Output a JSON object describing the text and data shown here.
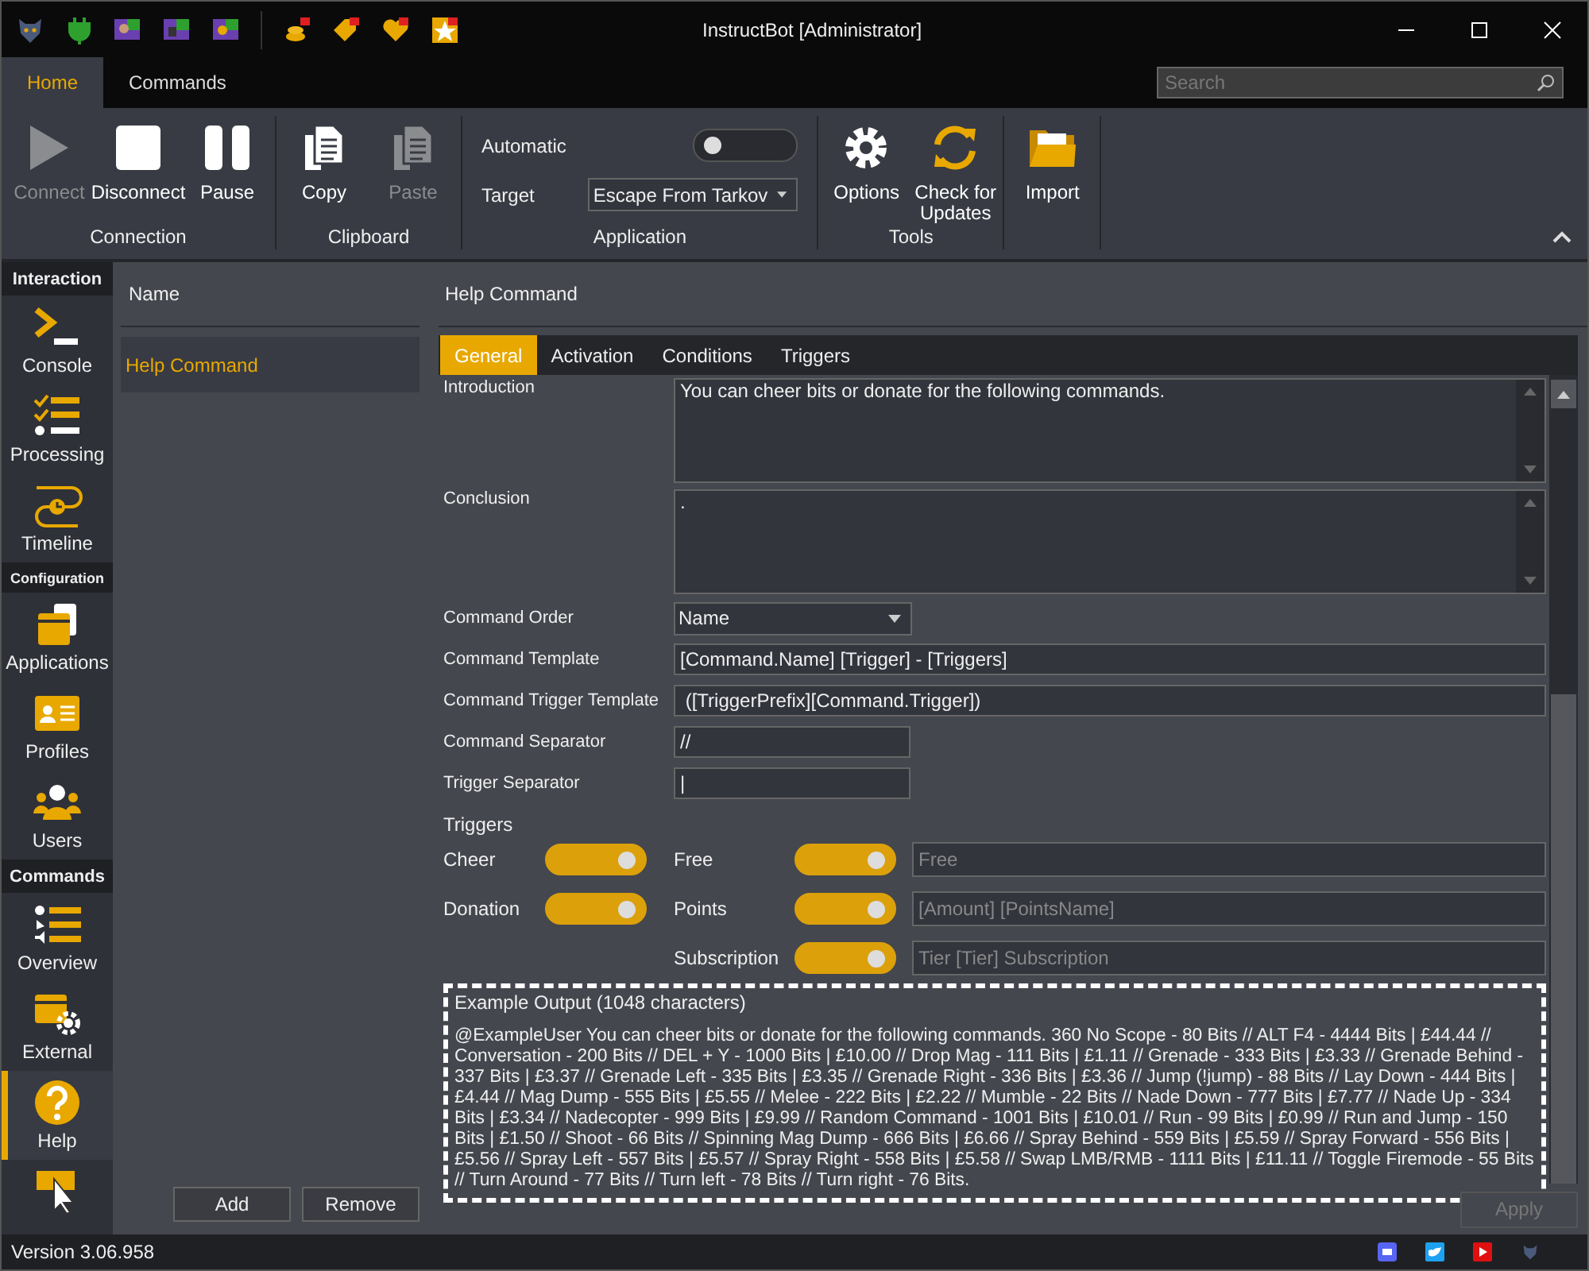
{
  "window": {
    "title": "InstructBot [Administrator]"
  },
  "ribbon_tabs": [
    {
      "label": "Home",
      "selected": true
    },
    {
      "label": "Commands",
      "selected": false
    }
  ],
  "search": {
    "placeholder": "Search"
  },
  "ribbon_groups": [
    {
      "label": "Connection",
      "buttons": [
        {
          "label": "Connect",
          "disabled": true
        },
        {
          "label": "Disconnect",
          "disabled": false
        },
        {
          "label": "Pause",
          "disabled": false
        }
      ]
    },
    {
      "label": "Clipboard",
      "buttons": [
        {
          "label": "Copy",
          "disabled": false
        },
        {
          "label": "Paste",
          "disabled": true
        }
      ]
    },
    {
      "label": "Application",
      "automatic": {
        "label": "Automatic",
        "on": false
      },
      "target": {
        "label": "Target",
        "value": "Escape From Tarkov"
      }
    },
    {
      "label": "Tools",
      "buttons": [
        {
          "label": "Options",
          "disabled": false
        },
        {
          "label": "Check for Updates",
          "disabled": false
        }
      ]
    },
    {
      "buttons": [
        {
          "label": "Import",
          "disabled": false
        }
      ]
    }
  ],
  "sidebar": [
    {
      "heading": "Interaction",
      "items": [
        {
          "label": "Console",
          "selected": false
        },
        {
          "label": "Processing",
          "selected": false
        },
        {
          "label": "Timeline",
          "selected": false
        }
      ]
    },
    {
      "heading": "Configuration",
      "items": [
        {
          "label": "Applications",
          "selected": false
        },
        {
          "label": "Profiles",
          "selected": false
        },
        {
          "label": "Users",
          "selected": false
        }
      ]
    },
    {
      "heading": "Commands",
      "items": [
        {
          "label": "Overview",
          "selected": false
        },
        {
          "label": "External",
          "selected": false
        },
        {
          "label": "Help",
          "selected": true
        },
        {
          "selected": false
        }
      ]
    }
  ],
  "list": {
    "header": "Name",
    "items": [
      {
        "label": "Help Command",
        "selected": true
      }
    ],
    "buttons": [
      "Add",
      "Remove"
    ]
  },
  "detail": {
    "header": "Help Command",
    "tabs": [
      {
        "label": "General",
        "selected": true
      },
      {
        "label": "Activation",
        "selected": false
      },
      {
        "label": "Conditions",
        "selected": false
      },
      {
        "label": "Triggers",
        "selected": false
      }
    ],
    "introduction": {
      "label": "Introduction",
      "value": "You can cheer bits or donate for the following commands."
    },
    "conclusion": {
      "label": "Conclusion",
      "value": "."
    },
    "command_order": {
      "label": "Command Order",
      "value": "Name"
    },
    "fields": [
      {
        "label": "Command Template",
        "value": "[Command.Name] [Trigger] - [Triggers]",
        "wide": true
      },
      {
        "label": "Command Trigger Template",
        "value": " ([TriggerPrefix][Command.Trigger])",
        "wide": true
      },
      {
        "label": "Command Separator",
        "value": "//",
        "wide": false
      },
      {
        "label": "Trigger Separator",
        "value": "|",
        "wide": false
      }
    ],
    "triggers_label": "Triggers",
    "trigger_rows": [
      {
        "left": {
          "label": "Cheer",
          "on": true
        },
        "right": {
          "label": "Free",
          "on": true,
          "placeholder": "Free"
        }
      },
      {
        "left": {
          "label": "Donation",
          "on": true
        },
        "right": {
          "label": "Points",
          "on": true,
          "placeholder": "[Amount] [PointsName]"
        }
      },
      {
        "right": {
          "label": "Subscription",
          "on": true,
          "placeholder": "Tier [Tier] Subscription"
        }
      }
    ],
    "example_title": "Example Output (1048 characters)",
    "example_text": "@ExampleUser You can cheer bits or donate for the following commands. 360 No Scope  - 80 Bits // ALT F4  - 4444 Bits | £44.44 // Conversation  - 200 Bits // DEL + Y  - 1000 Bits | £10.00 // Drop Mag  - 111 Bits | £1.11 // Grenade  - 333 Bits | £3.33 // Grenade Behind  - 337 Bits | £3.37 // Grenade Left  - 335 Bits | £3.35 // Grenade Right  - 336 Bits | £3.36 // Jump  (!jump) - 88 Bits // Lay Down  - 444 Bits | £4.44 // Mag Dump  - 555 Bits | £5.55 // Melee  - 222 Bits | £2.22 // Mumble  - 22 Bits // Nade Down  - 777 Bits | £7.77 // Nade Up  - 334 Bits | £3.34 // Nadecopter  - 999 Bits | £9.99 // Random Command  - 1001 Bits | £10.01 // Run  - 99 Bits | £0.99 // Run and Jump  - 150 Bits | £1.50 // Shoot  - 66 Bits // Spinning Mag Dump  - 666 Bits | £6.66 // Spray Behind  - 559 Bits | £5.59 // Spray Forward  - 556 Bits | £5.56 // Spray Left  - 557 Bits | £5.57 // Spray Right  - 558 Bits | £5.58 // Swap LMB/RMB  - 1111 Bits | £11.11 // Toggle Firemode  - 55 Bits // Turn Around  - 77 Bits // Turn left  - 78 Bits // Turn right  - 76 Bits.",
    "apply": {
      "label": "Apply",
      "disabled": true
    }
  },
  "status_bar": {
    "version": "Version 3.06.958"
  }
}
